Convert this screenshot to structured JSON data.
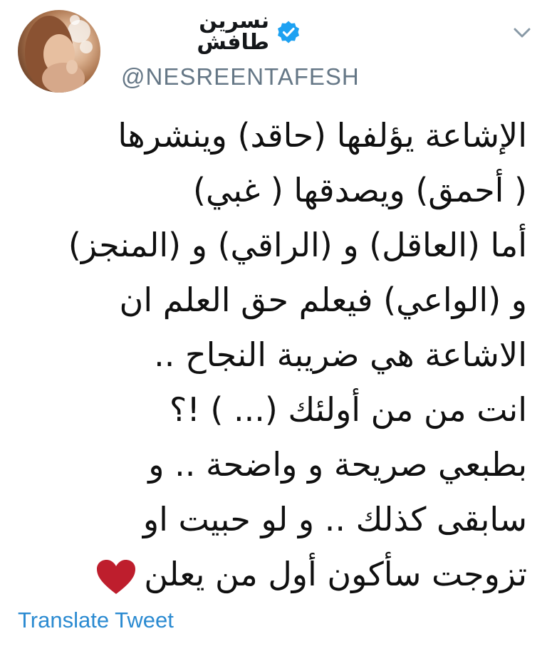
{
  "tweet": {
    "author": {
      "display_name": "نسرين طافش",
      "handle": "@NESREENTAFESH",
      "verified": true,
      "avatar_icon": "profile-photo"
    },
    "menu_icon": "chevron-down-icon",
    "text_lines": [
      "الإشاعة يؤلفها (حاقد) وينشرها",
      "( أحمق) ويصدقها ( غبي)",
      "أما (العاقل) و (الراقي) و (المنجز)",
      "و (الواعي) فيعلم حق العلم ان",
      "الاشاعة هي ضريبة النجاح ..",
      "انت من من أولئك (... ) !؟",
      "بطبعي صريحة و واضحة .. و",
      "سابقى كذلك .. و لو حبيت او",
      "تزوجت سأكون أول من يعلن"
    ],
    "emoji": "heart",
    "translate_label": "Translate Tweet"
  },
  "colors": {
    "verified_badge": "#1da1f2",
    "handle": "#657786",
    "link": "#2a8ad1",
    "heart": "#be1e2d",
    "text": "#101010"
  }
}
